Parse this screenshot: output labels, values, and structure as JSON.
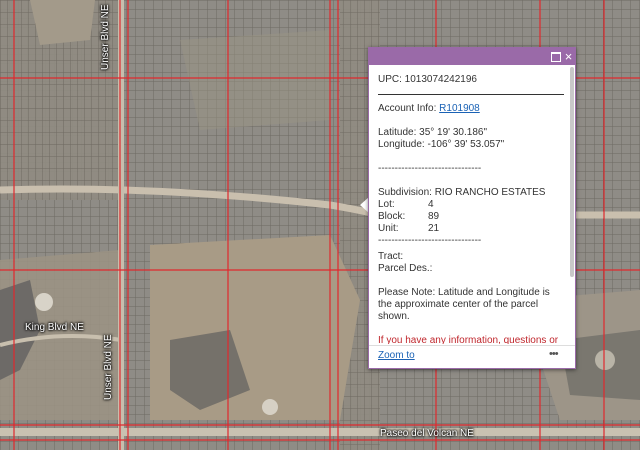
{
  "map": {
    "road_labels": {
      "unser_north": "Unser Blvd NE",
      "unser_south": "Unser Blvd NE",
      "king": "King Blvd NE",
      "paseo": "Paseo del Volcan NE"
    }
  },
  "popup": {
    "upc": "UPC: 1013074242196",
    "account_label": "Account Info: ",
    "account_link": "R101908",
    "latitude": "Latitude: 35° 19' 30.186\"",
    "longitude": "Longitude: -106° 39' 53.057\"",
    "separator": "-------------------------------",
    "subdivision": "Subdivision: RIO RANCHO ESTATES",
    "lot_label": "Lot:",
    "lot_value": "4",
    "block_label": "Block:",
    "block_value": "89",
    "unit_label": "Unit:",
    "unit_value": "21",
    "separator2": "-------------------------------",
    "tract": "Tract:",
    "parcel_des": "Parcel Des.:",
    "note": "Please Note: Latitude and Longitude is the approximate center of the parcel shown.",
    "info_red": "If you have any information, questions or",
    "zoom_to": "Zoom to",
    "more": "•••",
    "close_icon": "×"
  },
  "colors": {
    "header": "#9a6aa8",
    "link": "#1a62b5",
    "red_text": "#c0272d",
    "parcel_line": "#e0282d"
  }
}
